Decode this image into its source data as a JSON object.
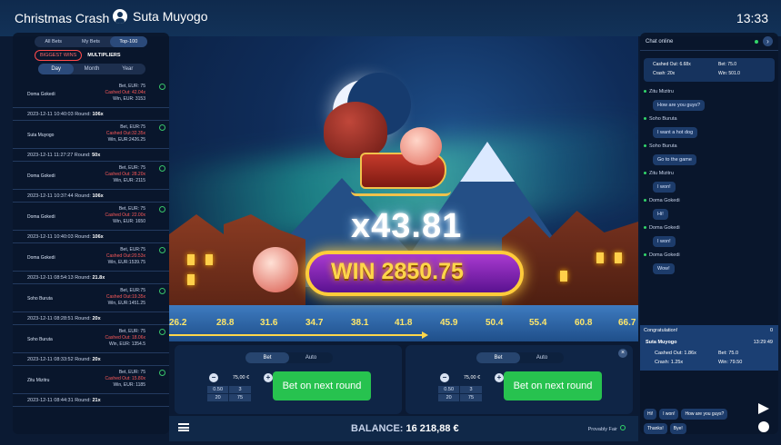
{
  "header": {
    "title": "Christmas Crash",
    "user": "Suta Muyogo",
    "time": "13:33"
  },
  "left": {
    "tabs": [
      "All Bets",
      "My Bets",
      "Top-100"
    ],
    "filters": [
      "BIGGEST WINS",
      "MULTIPLIERS"
    ],
    "periods": [
      "Day",
      "Month",
      "Year"
    ],
    "entries": [
      {
        "name": "Doma Gokedi",
        "bet": "Bet, EUR: 75",
        "cashed": "Cashed Out: 42.04x",
        "win": "Win, EUR: 3153",
        "date": "2023-12-11 10:40:03",
        "round": "106x"
      },
      {
        "name": "Suta Muyogo",
        "bet": "Bet, EUR:75",
        "cashed": "Cashed Out:32.35x",
        "win": "Win, EUR:2426.25",
        "date": "2023-12-11 11:27:27",
        "round": "50x"
      },
      {
        "name": "Doma Gokedi",
        "bet": "Bet, EUR: 75",
        "cashed": "Cashed Out: 28.20x",
        "win": "Win, EUR: 2115",
        "date": "2023-12-11 10:37:44",
        "round": "106x"
      },
      {
        "name": "Doma Gokedi",
        "bet": "Bet, EUR: 75",
        "cashed": "Cashed Out: 22.00x",
        "win": "Win, EUR: 1650",
        "date": "2023-12-11 10:40:03",
        "round": "106x"
      },
      {
        "name": "Doma Gokedi",
        "bet": "Bet, EUR:75",
        "cashed": "Cashed Out:20.53x",
        "win": "Win, EUR:1539.75",
        "date": "2023-12-11 08:54:13",
        "round": "21.8x"
      },
      {
        "name": "Soho Buruta",
        "bet": "Bet, EUR:75",
        "cashed": "Cashed Out:19.35x",
        "win": "Win, EUR:1451.25",
        "date": "2023-12-11 08:28:51",
        "round": "20x"
      },
      {
        "name": "Soho Buruta",
        "bet": "Bet, EUR: 75",
        "cashed": "Cashed Out: 18.06x",
        "win": "Win, EUR: 1354.5",
        "date": "2023-12-11 08:33:52",
        "round": "20x"
      },
      {
        "name": "Zitu Mizitru",
        "bet": "Bet, EUR: 75",
        "cashed": "Cashed Out: 15.80x",
        "win": "Win, EUR: 1185",
        "date": "2023-12-11 08:44:31",
        "round": "21x"
      }
    ],
    "round_label": "Round:"
  },
  "game": {
    "multiplier": "x43.81",
    "win": "WIN 2850.75",
    "axis": [
      "26.2",
      "28.8",
      "31.6",
      "34.7",
      "38.1",
      "41.8",
      "45.9",
      "50.4",
      "55.4",
      "60.8",
      "66.7"
    ]
  },
  "bet1": {
    "tabs": [
      "Bet",
      "Auto"
    ],
    "amount": "75,00 €",
    "chips": [
      "0.50",
      "3",
      "20",
      "75"
    ],
    "button": "Bet on next round"
  },
  "bet2": {
    "tabs": [
      "Bet",
      "Auto"
    ],
    "amount": "75,00 €",
    "chips": [
      "0.50",
      "3",
      "20",
      "75"
    ],
    "button": "Bet on next round"
  },
  "bottom": {
    "balance_label": "BALANCE:",
    "balance_value": "16 218,88 €",
    "fair": "Provably Fair"
  },
  "chat": {
    "title": "Chat online",
    "card": {
      "cashed": "Cashed Out: 6.68x",
      "crash": "Crash: 20x",
      "bet": "Bet: 75.0",
      "win": "Win: 501.0"
    },
    "messages": [
      {
        "user": "Zitu Mizitru",
        "text": "How are you guys?"
      },
      {
        "user": "Soho Buruta",
        "text": "I want a hot dog"
      },
      {
        "user": "Soho Buruta",
        "text": "Go to the game"
      },
      {
        "user": "Zitu Mizitru",
        "text": "I won!"
      },
      {
        "user": "Doma Gokedi",
        "text": "Hi!"
      },
      {
        "user": "Doma Gokedi",
        "text": "I won!"
      },
      {
        "user": "Doma Gokedi",
        "text": "Wow!"
      }
    ],
    "congrats": {
      "title": "Congratulation!",
      "likes": "0",
      "user": "Suta Muyogo",
      "time": "13:29:49",
      "cashed": "Cashed Out: 1.86x",
      "crash": "Crash: 1.25x",
      "bet": "Bet: 75.0",
      "win": "Win: 79.50"
    },
    "quick": [
      "Hi!",
      "I won!",
      "How are you guys?",
      "Thanks!",
      "Bye!"
    ]
  }
}
